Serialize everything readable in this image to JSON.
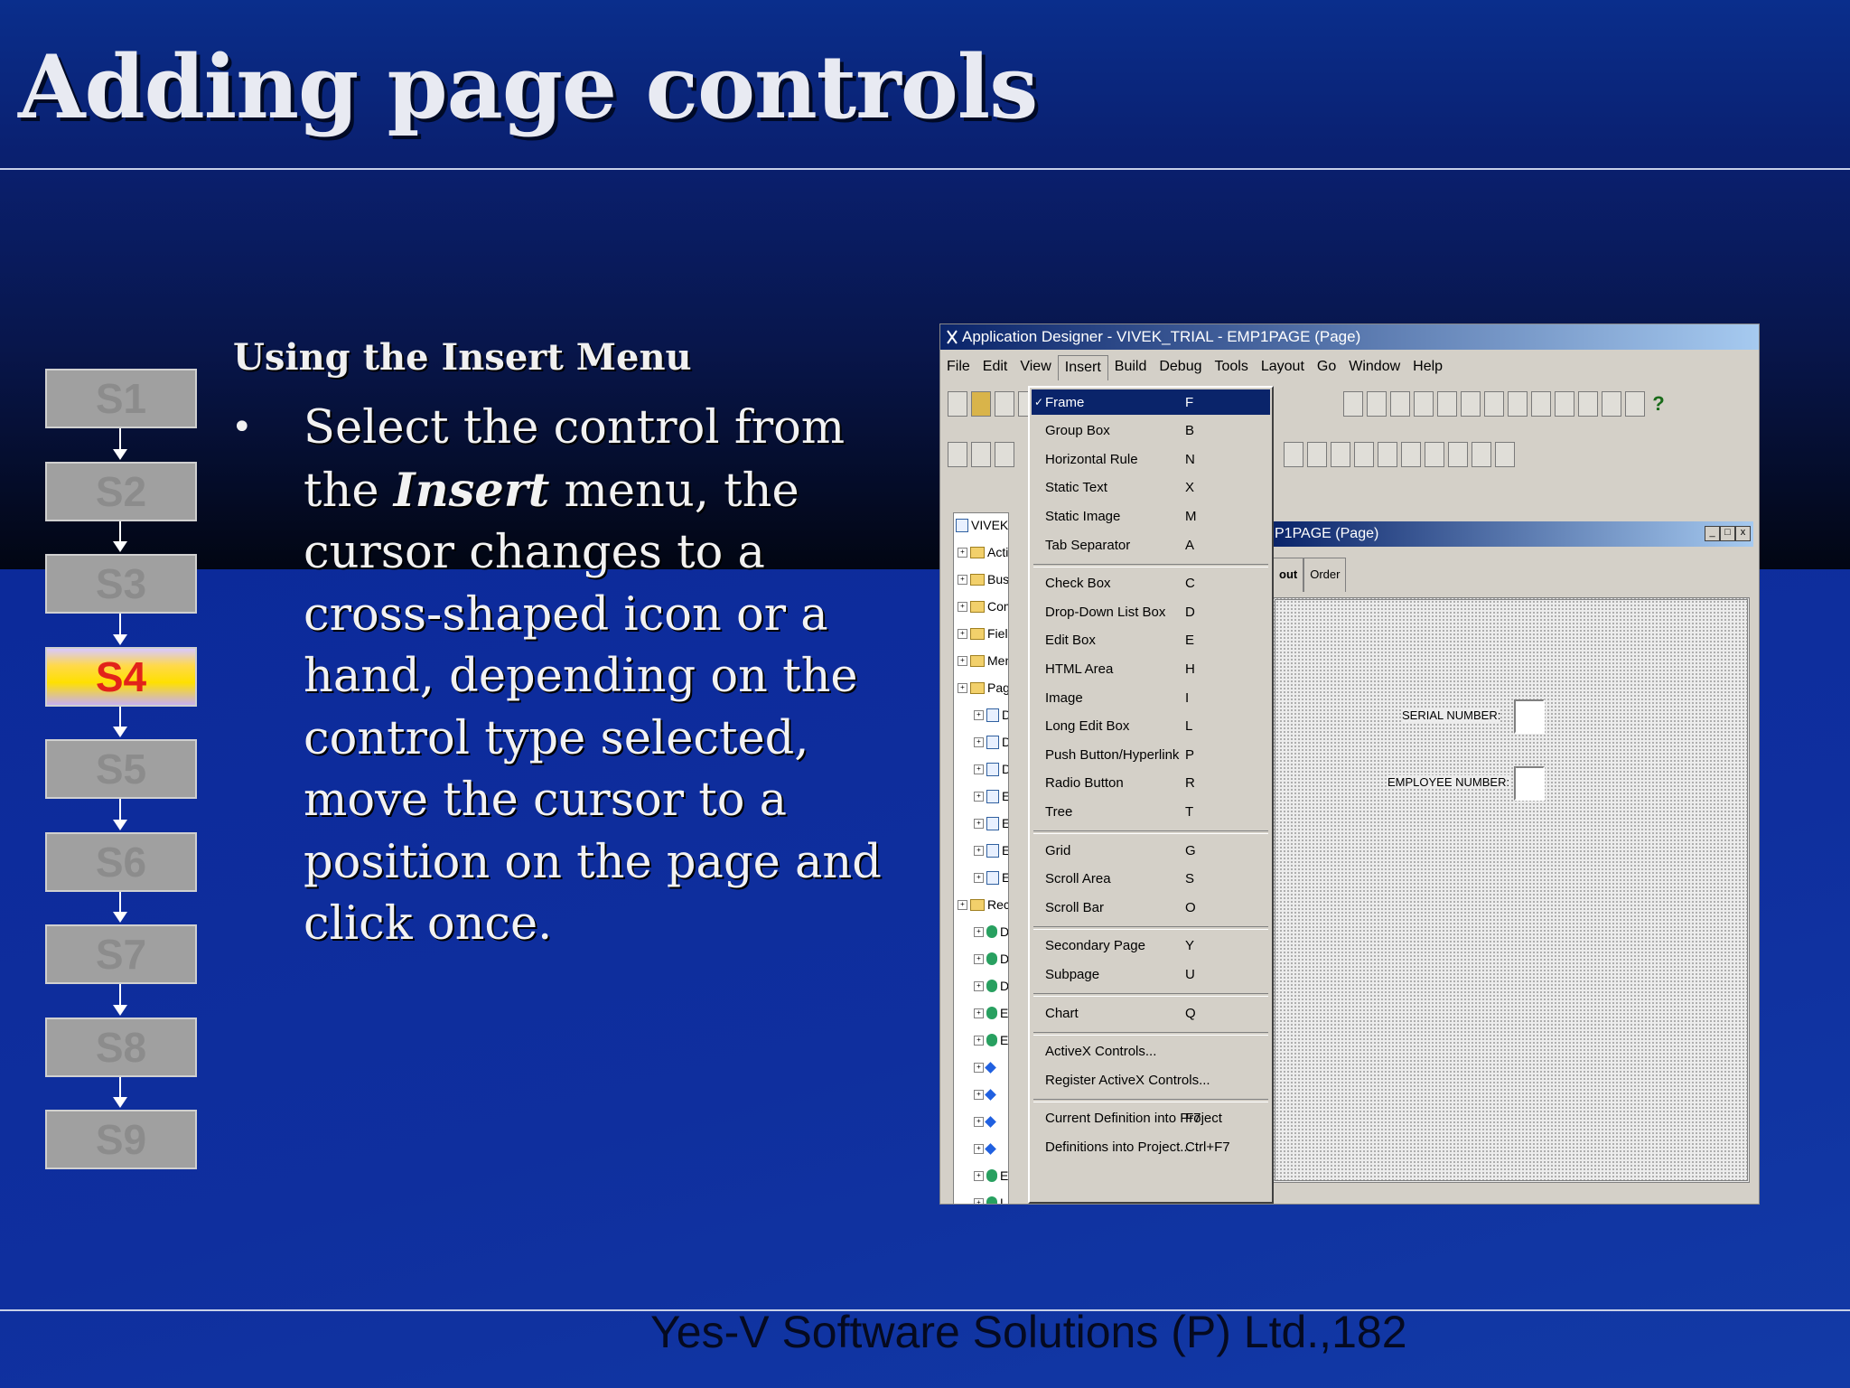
{
  "slide": {
    "title": "Adding page controls",
    "heading": "Using the Insert Menu",
    "bullet_char": "•",
    "body_before": "Select the control from the ",
    "body_emph": "Insert",
    "body_after": " menu, the cursor changes to a cross-shaped icon or a hand, depending on the control type selected, move the cursor to a position on the page and click once.",
    "footer": "Yes-V Software Solutions (P) Ltd.,182"
  },
  "steps": [
    "S1",
    "S2",
    "S3",
    "S4",
    "S5",
    "S6",
    "S7",
    "S8",
    "S9"
  ],
  "active_step": "S4",
  "app": {
    "title": "Application Designer - VIVEK_TRIAL - EMP1PAGE (Page)",
    "menubar": [
      "File",
      "Edit",
      "View",
      "Insert",
      "Build",
      "Debug",
      "Tools",
      "Layout",
      "Go",
      "Window",
      "Help"
    ],
    "open_menu": "Insert",
    "insert_menu": [
      {
        "label": "Frame",
        "key": "F",
        "checked": true,
        "selected": true
      },
      {
        "label": "Group Box",
        "key": "B"
      },
      {
        "label": "Horizontal Rule",
        "key": "N"
      },
      {
        "label": "Static Text",
        "key": "X"
      },
      {
        "label": "Static Image",
        "key": "M"
      },
      {
        "label": "Tab Separator",
        "key": "A"
      },
      {
        "label": "Check Box",
        "key": "C"
      },
      {
        "label": "Drop-Down List Box",
        "key": "D"
      },
      {
        "label": "Edit Box",
        "key": "E"
      },
      {
        "label": "HTML Area",
        "key": "H"
      },
      {
        "label": "Image",
        "key": "I"
      },
      {
        "label": "Long Edit Box",
        "key": "L"
      },
      {
        "label": "Push Button/Hyperlink",
        "key": "P"
      },
      {
        "label": "Radio Button",
        "key": "R"
      },
      {
        "label": "Tree",
        "key": "T"
      },
      {
        "label": "Grid",
        "key": "G"
      },
      {
        "label": "Scroll Area",
        "key": "S"
      },
      {
        "label": "Scroll Bar",
        "key": "O"
      },
      {
        "label": "Secondary Page",
        "key": "Y"
      },
      {
        "label": "Subpage",
        "key": "U"
      },
      {
        "label": "Chart",
        "key": "Q"
      },
      {
        "label": "ActiveX Controls...",
        "key": ""
      },
      {
        "label": "Register ActiveX Controls...",
        "key": ""
      },
      {
        "label": "Current Definition into Project",
        "key": "F7"
      },
      {
        "label": "Definitions into Project...",
        "key": "Ctrl+F7"
      }
    ],
    "tree": [
      "VIVEK_TRIA",
      "Activitie",
      "Busines",
      "Compo",
      "Fields",
      "Menus",
      "Pages",
      "DEF",
      "DEF",
      "DEF",
      "EMI",
      "EMI",
      "EMI",
      "EMI",
      "Record",
      "DEF",
      "DEF",
      "DEF",
      "EMI",
      "EMI",
      "",
      "",
      "",
      "",
      "EMI",
      "LIST"
    ],
    "page_window_title": "P1PAGE (Page)",
    "tabs": [
      "out",
      "Order"
    ],
    "fields": [
      {
        "label": "SERIAL NUMBER:"
      },
      {
        "label": "EMPLOYEE NUMBER:"
      }
    ],
    "window_buttons": [
      "_",
      "□",
      "x"
    ]
  }
}
